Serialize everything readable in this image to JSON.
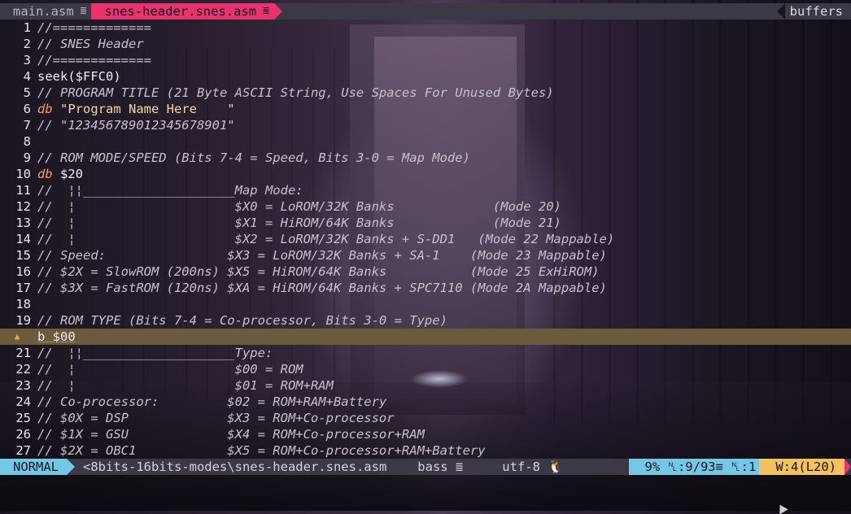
{
  "tabs": [
    {
      "label": "main.asm",
      "icon": "≣",
      "active": false
    },
    {
      "label": "snes-header.snes.asm",
      "icon": "≣",
      "active": true
    }
  ],
  "buffers_label": "buffers",
  "lines": [
    {
      "num": "1",
      "segs": [
        {
          "t": "//=============",
          "c": "comment"
        }
      ]
    },
    {
      "num": "2",
      "segs": [
        {
          "t": "// SNES Header",
          "c": "comment"
        }
      ]
    },
    {
      "num": "3",
      "segs": [
        {
          "t": "//=============",
          "c": "comment"
        }
      ]
    },
    {
      "num": "4",
      "segs": [
        {
          "t": "seek($FFC0)",
          "c": "plain"
        }
      ]
    },
    {
      "num": "5",
      "segs": [
        {
          "t": "// PROGRAM TITLE (21 Byte ASCII String, Use Spaces For Unused Bytes)",
          "c": "comment"
        }
      ]
    },
    {
      "num": "6",
      "segs": [
        {
          "t": "db",
          "c": "kw"
        },
        {
          "t": " \"Program Name Here    \"",
          "c": "str"
        }
      ]
    },
    {
      "num": "7",
      "segs": [
        {
          "t": "// \"123456789012345678901\"",
          "c": "comment"
        }
      ]
    },
    {
      "num": "8",
      "segs": []
    },
    {
      "num": "9",
      "segs": [
        {
          "t": "// ROM MODE/SPEED (Bits 7-4 = Speed, Bits 3-0 = Map Mode)",
          "c": "comment"
        }
      ]
    },
    {
      "num": "10",
      "segs": [
        {
          "t": "db",
          "c": "kw"
        },
        {
          "t": " $20",
          "c": "plain"
        }
      ]
    },
    {
      "num": "11",
      "segs": [
        {
          "t": "//  ¦¦____________________Map Mode:",
          "c": "comment"
        }
      ]
    },
    {
      "num": "12",
      "segs": [
        {
          "t": "//  ¦                     $X0 = LoROM/32K Banks             (Mode 20)",
          "c": "comment"
        }
      ]
    },
    {
      "num": "13",
      "segs": [
        {
          "t": "//  ¦                     $X1 = HiROM/64K Banks             (Mode 21)",
          "c": "comment"
        }
      ]
    },
    {
      "num": "14",
      "segs": [
        {
          "t": "//  ¦                     $X2 = LoROM/32K Banks + S-DD1   (Mode 22 Mappable)",
          "c": "comment"
        }
      ]
    },
    {
      "num": "15",
      "segs": [
        {
          "t": "// Speed:                $X3 = LoROM/32K Banks + SA-1    (Mode 23 Mappable)",
          "c": "comment"
        }
      ]
    },
    {
      "num": "16",
      "segs": [
        {
          "t": "// $2X = SlowROM (200ns) $X5 = HiROM/64K Banks           (Mode 25 ExHiROM)",
          "c": "comment"
        }
      ]
    },
    {
      "num": "17",
      "segs": [
        {
          "t": "// $3X = FastROM (120ns) $XA = HiROM/64K Banks + SPC7110 (Mode 2A Mappable)",
          "c": "comment"
        }
      ]
    },
    {
      "num": "18",
      "segs": []
    },
    {
      "num": "19",
      "segs": [
        {
          "t": "// ROM TYPE (Bits 7-4 = Co-processor, Bits 3-0 = Type)",
          "c": "comment"
        }
      ]
    },
    {
      "num": "▲",
      "segs": [
        {
          "t": "b $00",
          "c": "plain"
        }
      ],
      "current": true
    },
    {
      "num": "21",
      "segs": [
        {
          "t": "//  ¦¦____________________Type:",
          "c": "comment"
        }
      ]
    },
    {
      "num": "22",
      "segs": [
        {
          "t": "//  ¦                     $00 = ROM",
          "c": "comment"
        }
      ]
    },
    {
      "num": "23",
      "segs": [
        {
          "t": "//  ¦                     $01 = ROM+RAM",
          "c": "comment"
        }
      ]
    },
    {
      "num": "24",
      "segs": [
        {
          "t": "// Co-processor:         $02 = ROM+RAM+Battery",
          "c": "comment"
        }
      ]
    },
    {
      "num": "25",
      "segs": [
        {
          "t": "// $0X = DSP             $X3 = ROM+Co-processor",
          "c": "comment"
        }
      ]
    },
    {
      "num": "26",
      "segs": [
        {
          "t": "// $1X = GSU             $X4 = ROM+Co-processor+RAM",
          "c": "comment"
        }
      ]
    },
    {
      "num": "27",
      "segs": [
        {
          "t": "// $2X = OBC1            $X5 = ROM+Co-processor+RAM+Battery",
          "c": "comment"
        }
      ]
    }
  ],
  "status": {
    "mode": "NORMAL",
    "file": "<8bits-16bits-modes\\snes-header.snes.asm",
    "filetype": "bass ≣",
    "encoding": "utf-8 🐧",
    "position": "9% ␤:9/93≡ ␤:1 ",
    "warning": "W:4(L20)"
  },
  "colors": {
    "accent_pink": "#e8336e",
    "accent_cyan": "#74c8e6",
    "accent_yellow": "#f5c060",
    "bar_bg": "#3c3846"
  }
}
